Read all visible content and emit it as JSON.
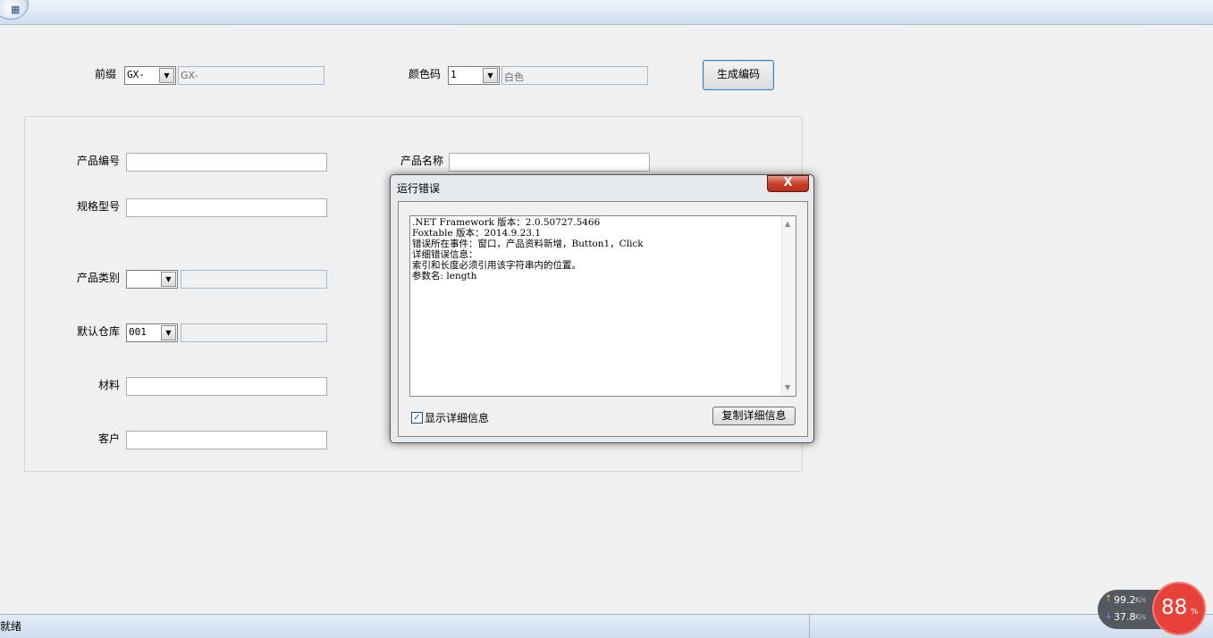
{
  "window": {
    "app_glyph": "▦"
  },
  "top": {
    "prefix_label": "前缀",
    "prefix_value": "GX-",
    "prefix_text": "GX-",
    "color_code_label": "颜色码",
    "color_code_value": "1",
    "color_name": "白色",
    "generate_button": "生成编码"
  },
  "form": {
    "product_code_label": "产品编号",
    "product_code_value": "",
    "product_name_label": "产品名称",
    "product_name_value": "",
    "spec_label": "规格型号",
    "spec_value": "",
    "category_label": "产品类别",
    "category_value": "",
    "category_text": "",
    "warehouse_label": "默认仓库",
    "warehouse_value": "001",
    "warehouse_text": "",
    "material_label": "材料",
    "material_value": "",
    "customer_label": "客户",
    "customer_value": ""
  },
  "dialog": {
    "title": "运行错误",
    "close_glyph": "X",
    "lines": [
      ".NET Framework 版本：2.0.50727.5466",
      "Foxtable 版本：2014.9.23.1",
      "错误所在事件：窗口，产品资料新增，Button1，Click",
      "详细错误信息：",
      "索引和长度必须引用该字符串内的位置。",
      "参数名: length"
    ],
    "show_details_checked": true,
    "show_details_label": "显示详细信息",
    "copy_button": "复制详细信息"
  },
  "status": {
    "text": "就绪"
  },
  "net_widget": {
    "upload": "99.2",
    "upload_unit": "K/s",
    "download": "37.8",
    "download_unit": "K/s",
    "percent": "88",
    "percent_unit": "%"
  }
}
